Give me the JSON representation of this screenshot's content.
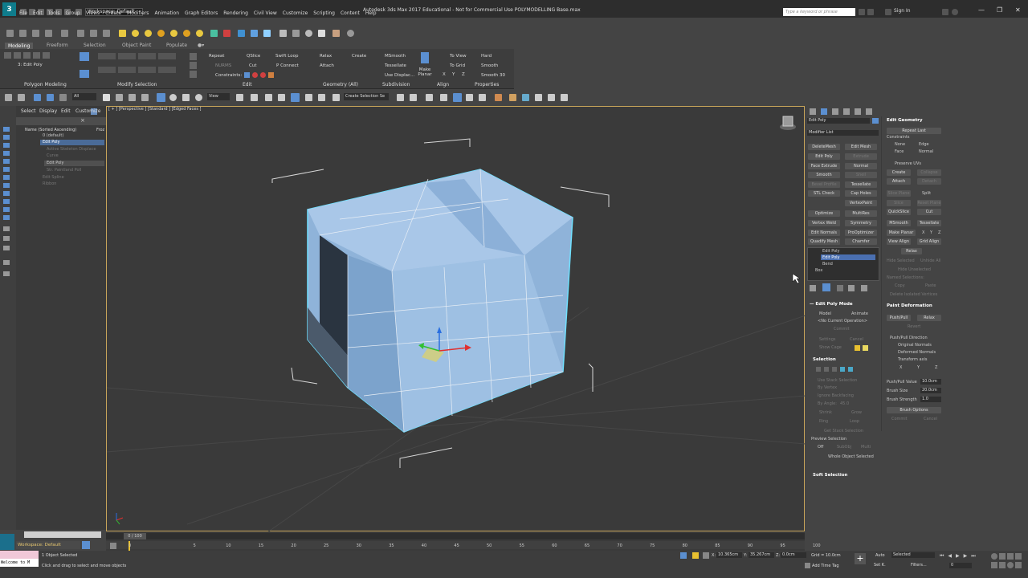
{
  "titlebar": {
    "logo": "3",
    "workspace": "Workspace: Default",
    "title": "Autodesk 3ds Max 2017 Educational - Not for Commercial Use    POLYMODELLING Base.max",
    "search_placeholder": "Type a keyword or phrase",
    "signin": "Sign In",
    "menu": [
      "File",
      "Edit",
      "Tools",
      "Group",
      "Views",
      "Create",
      "Modifiers",
      "Animation",
      "Graph Editors",
      "Rendering",
      "Civil View",
      "Customize",
      "Scripting",
      "Content",
      "Help"
    ]
  },
  "ribbon": {
    "tabs": [
      "Modeling",
      "Freeform",
      "Selection",
      "Object Paint",
      "Populate"
    ],
    "group_labels": [
      "Polygon Modeling",
      "Modify Selection",
      "Edit",
      "Geometry (All)",
      "Subdivision",
      "Align",
      "Properties"
    ],
    "edit_group": {
      "repeat": "Repeat",
      "qslice": "QSlice",
      "swift_loop": "Swift Loop",
      "nurms": "NURMS",
      "cut": "Cut",
      "p_connect": "P Connect",
      "constraints": "Constraints:"
    },
    "geometry_group": {
      "relax": "Relax",
      "create": "Create",
      "attach": "Attach"
    },
    "subdivision_group": {
      "msmooth": "MSmooth",
      "tessellate": "Tessellate",
      "use_displace": "Use Displac..."
    },
    "align_group": {
      "make_planar": "Make Planar",
      "to_view": "To View",
      "to_grid": "To Grid",
      "x": "X",
      "y": "Y",
      "z": "Z"
    },
    "properties_group": {
      "hard": "Hard",
      "smooth": "Smooth",
      "smooth30": "Smooth 30"
    },
    "poly_label": "3: Edit Poly"
  },
  "toolbar2": {
    "filter": "All",
    "view": "View",
    "selection_set": "Create Selection Se"
  },
  "scene_explorer": {
    "menu": [
      "Select",
      "Display",
      "Edit",
      "Customize"
    ],
    "header": "Name (Sorted Ascending)",
    "header_right": "Froz",
    "items": [
      "0 (default)",
      "Edit Poly",
      "Active Skeleton Displace",
      "Curve",
      "Edit Poly",
      "Str. Paintland Poll",
      "Edit Spline",
      "Ribbon"
    ],
    "workspace": "Workspace: Default"
  },
  "viewport": {
    "label": "[ + ] [Perspective ] [Standard ] [Edged Faces ]"
  },
  "cmdpanel": {
    "object_name": "Edit Poly",
    "modifier_list": "Modifier List",
    "buttons": [
      [
        "DeleteMesh",
        "Edit Mesh"
      ],
      [
        "Edit Poly",
        "Extrude"
      ],
      [
        "Face Extrude",
        "Normal"
      ],
      [
        "Smooth",
        "Shell"
      ],
      [
        "Bevel Profile",
        "Tessellate"
      ],
      [
        "STL Check",
        "Cap Holes"
      ],
      [
        "",
        "VertexPaint"
      ],
      [
        "Optimize",
        "MultiRes"
      ],
      [
        "Vertex Weld",
        "Symmetry"
      ],
      [
        "Edit Normals",
        "ProOptimizer"
      ],
      [
        "Quadify Mesh",
        "Chamfer"
      ]
    ],
    "stack": [
      "Edit Poly",
      "Edit Poly",
      "Bend",
      "Box"
    ],
    "edit_poly_mode": {
      "title": "Edit Poly Mode",
      "model": "Model",
      "animate": "Animate",
      "no_op": "<No Current Operation>",
      "commit": "Commit",
      "settings": "Settings",
      "cancel": "Cancel",
      "show_cage": "Show Cage"
    },
    "selection": {
      "title": "Selection",
      "use_stack": "Use Stack Selection",
      "by_vertex": "By Vertex",
      "ignore_bf": "Ignore Backfacing",
      "by_angle": "By Angle:",
      "angle_val": "45.0",
      "shrink": "Shrink",
      "grow": "Grow",
      "ring": "Ring",
      "loop": "Loop",
      "get_stack": "Get Stack Selection",
      "preview": "Preview Selection",
      "off": "Off",
      "subobj": "SubObj",
      "multi": "Multi",
      "whole": "Whole Object Selected"
    },
    "soft_selection": "Soft Selection"
  },
  "rollpanel": {
    "edit_geometry": "Edit Geometry",
    "repeat_last": "Repeat Last",
    "constraints": "Constraints",
    "none": "None",
    "edge": "Edge",
    "face": "Face",
    "normal": "Normal",
    "preserve_uvs": "Preserve UVs",
    "create": "Create",
    "collapse": "Collapse",
    "attach": "Attach",
    "detach": "Detach",
    "slice_plane": "Slice Plane",
    "split": "Split",
    "slice": "Slice",
    "reset_plane": "Reset Plane",
    "quickslice": "QuickSlice",
    "cut": "Cut",
    "msmooth": "MSmooth",
    "tessellate": "Tessellate",
    "make_planar": "Make Planar",
    "x": "X",
    "y": "Y",
    "z": "Z",
    "view_align": "View Align",
    "grid_align": "Grid Align",
    "relax": "Relax",
    "hide_selected": "Hide Selected",
    "unhide_all": "Unhide All",
    "hide_unselected": "Hide Unselected",
    "named_selections": "Named Selections:",
    "copy": "Copy",
    "paste": "Paste",
    "delete_isolated": "Delete Isolated Vertices",
    "paint_deformation": "Paint Deformation",
    "push_pull": "Push/Pull",
    "relax2": "Relax",
    "revert": "Revert",
    "direction": "Push/Pull Direction",
    "original_normals": "Original Normals",
    "deformed_normals": "Deformed Normals",
    "transform_axis": "Transform axis",
    "value_label": "Push/Pull Value",
    "value": "10.0cm",
    "brush_size": "Brush Size",
    "brush_size_val": "20.0cm",
    "brush_strength": "Brush Strength",
    "brush_strength_val": "1.0",
    "brush_options": "Brush Options",
    "commit": "Commit",
    "cancel": "Cancel"
  },
  "timeline": {
    "frame": "0 / 100",
    "ticks": [
      "0",
      "5",
      "10",
      "15",
      "20",
      "25",
      "30",
      "35",
      "40",
      "45",
      "50",
      "55",
      "60",
      "65",
      "70",
      "75",
      "80",
      "85",
      "90",
      "95",
      "100"
    ]
  },
  "status": {
    "selected": "1 Object Selected",
    "hint": "Click and drag to select and move objects",
    "welcome": "Welcome to M",
    "x_label": "X:",
    "x": "10.365cm",
    "y_label": "Y:",
    "y": "35.267cm",
    "z_label": "Z:",
    "z": "0.0cm",
    "grid": "Grid = 10.0cm",
    "add_time_tag": "Add Time Tag",
    "auto": "Auto",
    "set_k": "Set K.",
    "selected_combo": "Selected",
    "filters": "Filters...",
    "frame": "0"
  }
}
